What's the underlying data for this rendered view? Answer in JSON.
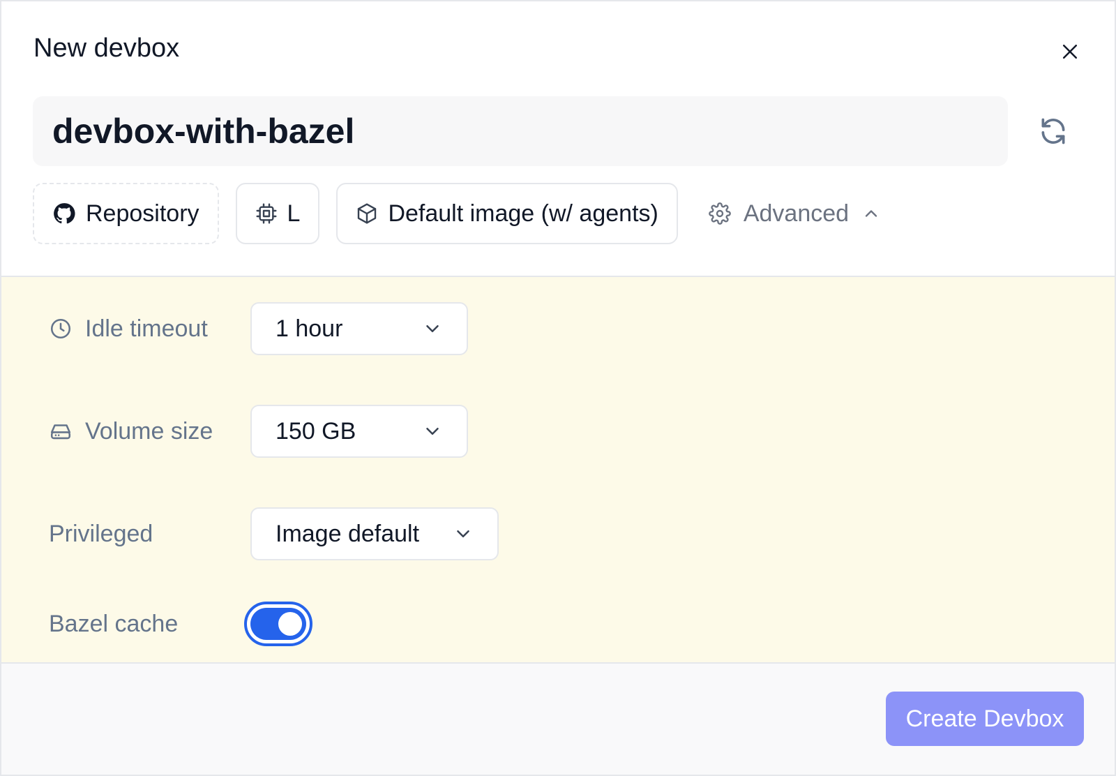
{
  "dialog": {
    "title": "New devbox",
    "name_value": "devbox-with-bazel"
  },
  "chips": {
    "repository": "Repository",
    "size": "L",
    "image": "Default image (w/ agents)",
    "advanced": "Advanced"
  },
  "advanced": {
    "idle_timeout": {
      "label": "Idle timeout",
      "value": "1 hour"
    },
    "volume_size": {
      "label": "Volume size",
      "value": "150 GB"
    },
    "privileged": {
      "label": "Privileged",
      "value": "Image default"
    },
    "bazel_cache": {
      "label": "Bazel cache",
      "enabled": true
    }
  },
  "footer": {
    "create_label": "Create Devbox"
  },
  "colors": {
    "accent": "#2563eb",
    "create_button": "#8c93f8",
    "advanced_panel_bg": "#fdfae8"
  },
  "icons": [
    "close-icon",
    "refresh-icon",
    "github-icon",
    "cpu-icon",
    "box-icon",
    "gear-icon",
    "chevron-up-icon",
    "clock-icon",
    "hard-drive-icon",
    "chevron-down-icon"
  ]
}
